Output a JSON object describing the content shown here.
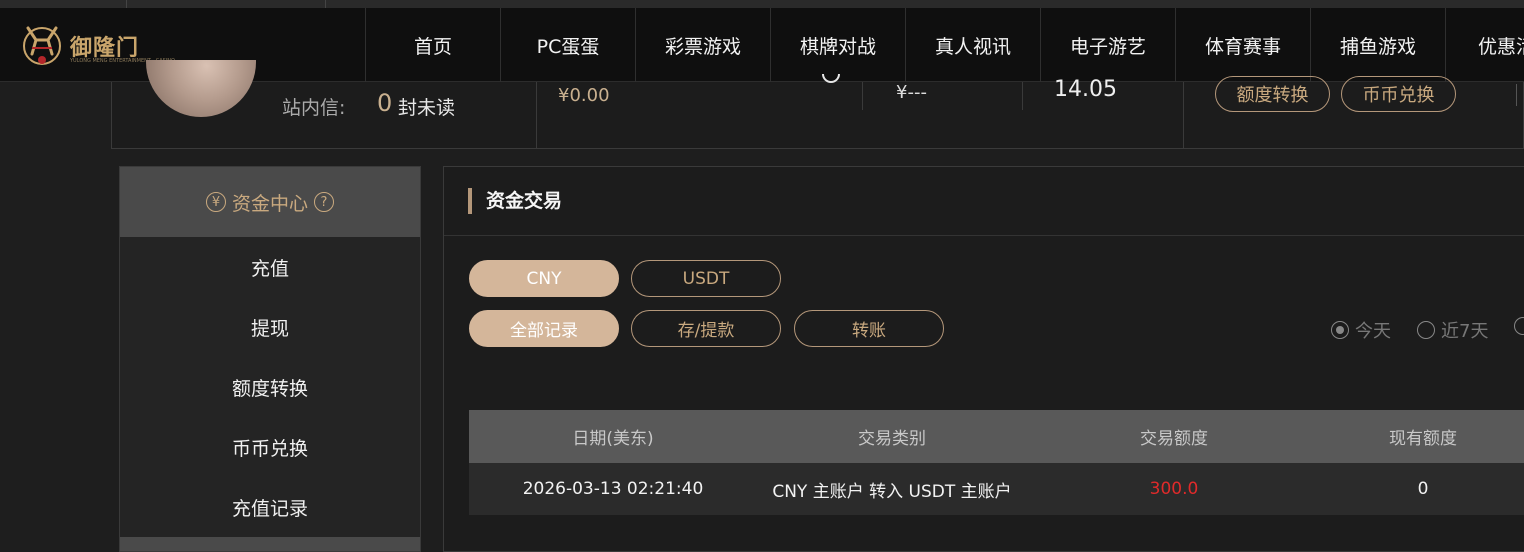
{
  "brand": {
    "name": "御隆门",
    "subtitle": "YULONG MENG ENTERTAINMENT · CASINO"
  },
  "nav": [
    "首页",
    "PC蛋蛋",
    "彩票游戏",
    "棋牌对战",
    "真人视讯",
    "电子游艺",
    "体育赛事",
    "捕鱼游戏",
    "优惠活动"
  ],
  "account": {
    "message_label": "站内信:",
    "unread_count": "0",
    "unread_suffix": "封未读",
    "balance": "¥0.00",
    "other_balance": "¥---",
    "value": "14.05",
    "transfer_button": "额度转换",
    "exchange_button": "币币兑换"
  },
  "sidebar": {
    "title": "资金中心",
    "help": "?",
    "items": [
      "充值",
      "提现",
      "额度转换",
      "币币兑换",
      "充值记录"
    ]
  },
  "main": {
    "title": "资金交易",
    "currency_tabs": [
      "CNY",
      "USDT"
    ],
    "record_tabs": [
      "全部记录",
      "存/提款",
      "转账"
    ],
    "date_filters": [
      "今天",
      "近7天"
    ]
  },
  "table": {
    "columns": [
      "日期(美东)",
      "交易类别",
      "交易额度",
      "现有额度"
    ],
    "rows": [
      {
        "date": "2026-03-13 02:21:40",
        "type": "CNY 主账户 转入 USDT 主账户",
        "amount": "300.0",
        "current": "0"
      }
    ]
  },
  "colors": {
    "accent": "#c9a97f",
    "pill_active": "#d4b69a",
    "amount_negative": "#e02a2a",
    "background": "#1e1e1e"
  }
}
